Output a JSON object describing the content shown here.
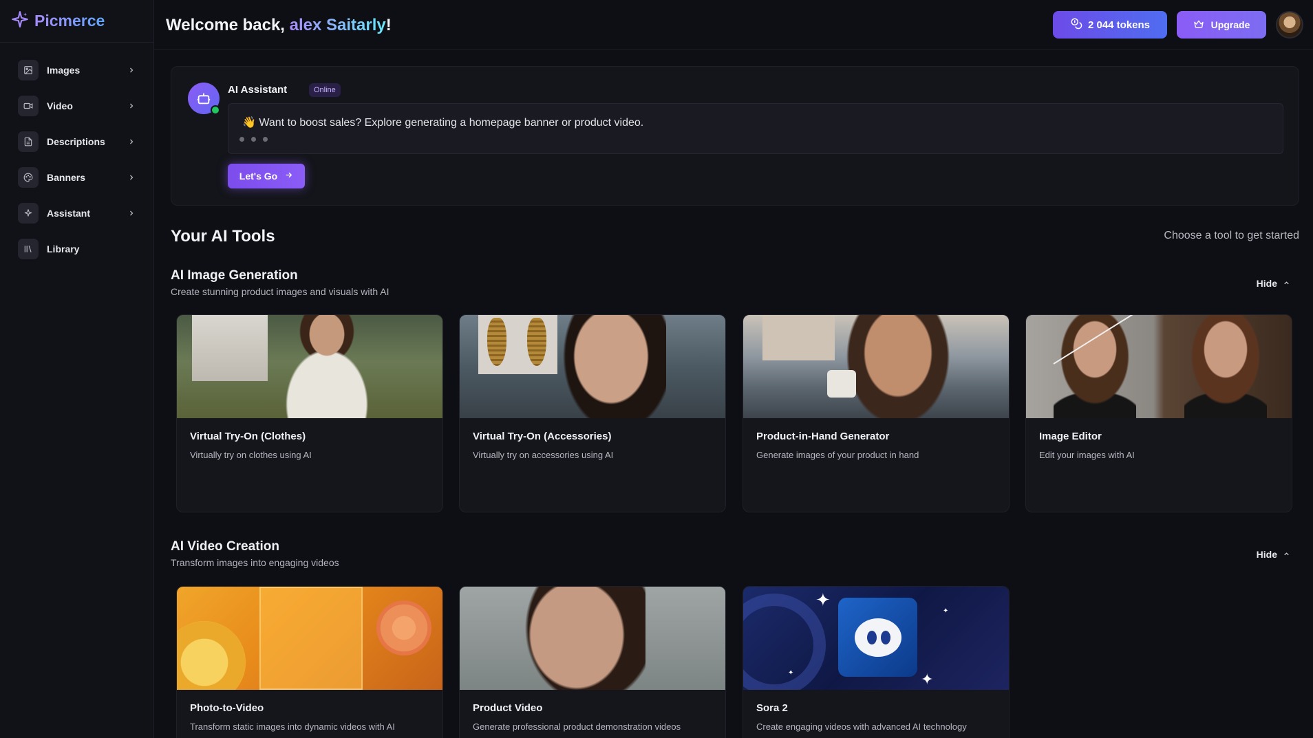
{
  "brand": {
    "name": "Picmerce",
    "logo_icon": "sparkle-icon"
  },
  "sidebar": {
    "items": [
      {
        "label": "Images",
        "icon": "image-icon",
        "has_chevron": true
      },
      {
        "label": "Video",
        "icon": "video-icon",
        "has_chevron": true
      },
      {
        "label": "Descriptions",
        "icon": "document-icon",
        "has_chevron": true
      },
      {
        "label": "Banners",
        "icon": "palette-icon",
        "has_chevron": true
      },
      {
        "label": "Assistant",
        "icon": "sparkles-icon",
        "has_chevron": true
      },
      {
        "label": "Library",
        "icon": "library-icon",
        "has_chevron": false
      }
    ]
  },
  "header": {
    "welcome_prefix": "Welcome back, ",
    "user_name": "alex Saitarly",
    "welcome_suffix": "!",
    "tokens_label": "2 044 tokens",
    "upgrade_label": "Upgrade"
  },
  "assistant": {
    "name": "AI Assistant",
    "status": "Online",
    "message": "👋 Want to boost sales? Explore generating a homepage banner or product video.",
    "cta_label": "Let's Go"
  },
  "tools": {
    "title": "Your AI Tools",
    "hint": "Choose a tool to get started"
  },
  "sections": [
    {
      "title": "AI Image Generation",
      "subtitle": "Create stunning product images and visuals with AI",
      "hide_label": "Hide",
      "cards": [
        {
          "title": "Virtual Try-On (Clothes)",
          "desc": "Virtually try on clothes using AI"
        },
        {
          "title": "Virtual Try-On (Accessories)",
          "desc": "Virtually try on accessories using AI"
        },
        {
          "title": "Product-in-Hand Generator",
          "desc": "Generate images of your product in hand"
        },
        {
          "title": "Image Editor",
          "desc": "Edit your images with AI"
        }
      ]
    },
    {
      "title": "AI Video Creation",
      "subtitle": "Transform images into engaging videos",
      "hide_label": "Hide",
      "cards": [
        {
          "title": "Photo-to-Video",
          "desc": "Transform static images into dynamic videos with AI"
        },
        {
          "title": "Product Video",
          "desc": "Generate professional product demonstration videos"
        },
        {
          "title": "Sora 2",
          "desc": "Create engaging videos with advanced AI technology"
        }
      ]
    }
  ],
  "colors": {
    "background": "#0e0f14",
    "sidebar": "#111217",
    "accent_purple": "#8b5cf6",
    "accent_blue": "#4f6df0",
    "online_green": "#22c55e"
  }
}
